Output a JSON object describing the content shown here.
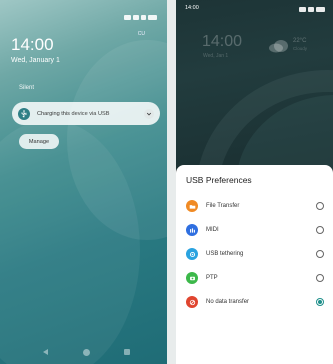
{
  "left_screen": {
    "time": "14:00",
    "date": "Wed, January 1",
    "carrier_tag": "CU",
    "section_label": "Silent",
    "notification": {
      "text": "Charging this device via USB",
      "icon": "usb-icon",
      "expand_icon": "chevron-down-icon"
    },
    "manage_label": "Manage"
  },
  "right_screen": {
    "status_time": "14:00",
    "lock_time": "14:00",
    "lock_date": "Wed, Jan 1",
    "weather_temp": "22°C",
    "weather_sub": "Cloudy",
    "sheet_title": "USB Preferences",
    "options": [
      {
        "label": "File Transfer",
        "icon": "folder-icon",
        "color": "#f08a24",
        "checked": false
      },
      {
        "label": "MIDI",
        "icon": "midi-icon",
        "color": "#2f6fe0",
        "checked": false
      },
      {
        "label": "USB tethering",
        "icon": "tethering-icon",
        "color": "#2aa3e0",
        "checked": false
      },
      {
        "label": "PTP",
        "icon": "photo-icon",
        "color": "#3cb84a",
        "checked": false
      },
      {
        "label": "No data transfer",
        "icon": "no-data-icon",
        "color": "#e0452f",
        "checked": true
      }
    ]
  },
  "colors": {
    "accent": "#1e8f8a",
    "notif_icon_bg": "#2f7f86"
  }
}
